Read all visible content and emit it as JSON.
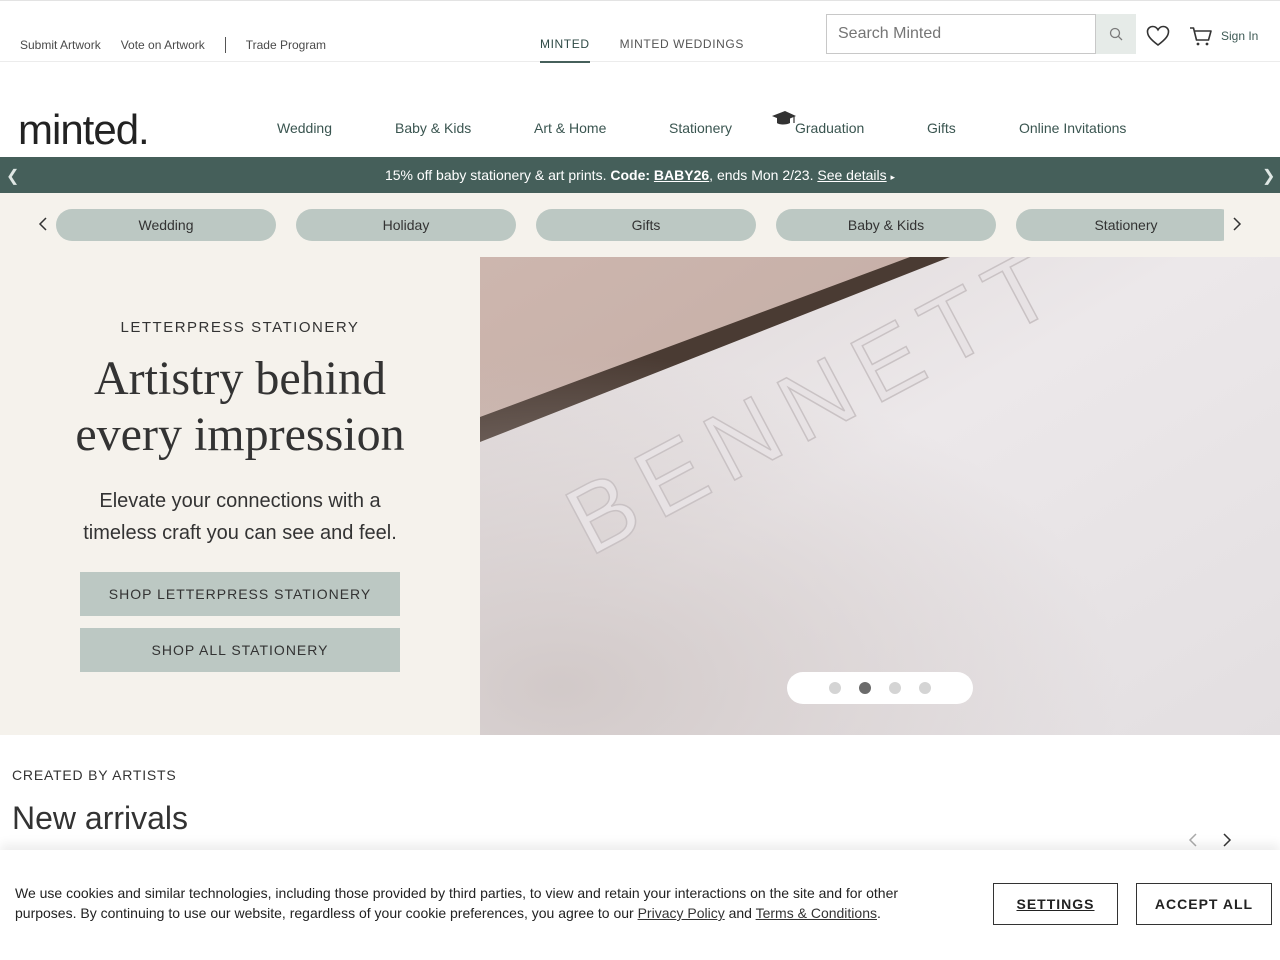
{
  "topbar": {
    "links": [
      "Submit Artwork",
      "Vote on Artwork",
      "Trade Program"
    ],
    "site_tabs": [
      "MINTED",
      "MINTED WEDDINGS"
    ],
    "search_placeholder": "Search Minted",
    "sign_in": "Sign In"
  },
  "logo": "minted.",
  "nav": [
    "Wedding",
    "Baby & Kids",
    "Art & Home",
    "Stationery",
    "Graduation",
    "Gifts",
    "Online Invitations"
  ],
  "promo": {
    "text_before": "15% off baby stationery & art prints. ",
    "code_label": "Code: ",
    "code": "BABY26",
    "text_after": ", ends Mon 2/23. ",
    "link": "See details",
    "caret": "▸"
  },
  "pills": [
    "Wedding",
    "Holiday",
    "Gifts",
    "Baby & Kids",
    "Stationery"
  ],
  "hero": {
    "eyebrow": "LETTERPRESS STATIONERY",
    "headline_line1": "Artistry behind",
    "headline_line2": "every impression",
    "subline": "Elevate your connections with a timeless craft you can see and feel.",
    "cta_primary": "SHOP LETTERPRESS STATIONERY",
    "cta_secondary": "SHOP ALL STATIONERY",
    "image_text": "BENNETT",
    "slides_count": 4,
    "active_slide": 2
  },
  "arrivals": {
    "eyebrow": "CREATED BY ARTISTS",
    "title": "New arrivals"
  },
  "cookie": {
    "text_before": "We use cookies and similar technologies, including those provided by third parties, to view and retain your interactions on the site and for other purposes. By continuing to use our website, regardless of your cookie preferences, you agree to our ",
    "privacy": "Privacy Policy",
    "and": " and ",
    "terms": "Terms & Conditions",
    "period": ".",
    "settings": "SETTINGS",
    "accept": "ACCEPT ALL"
  },
  "colors": {
    "accent": "#455f5a",
    "pill": "#bcc8c3",
    "cream": "#f5f2ec"
  },
  "icons": [
    "search-icon",
    "heart-icon",
    "cart-icon",
    "graduation-cap-icon",
    "chevron-left-icon",
    "chevron-right-icon"
  ]
}
